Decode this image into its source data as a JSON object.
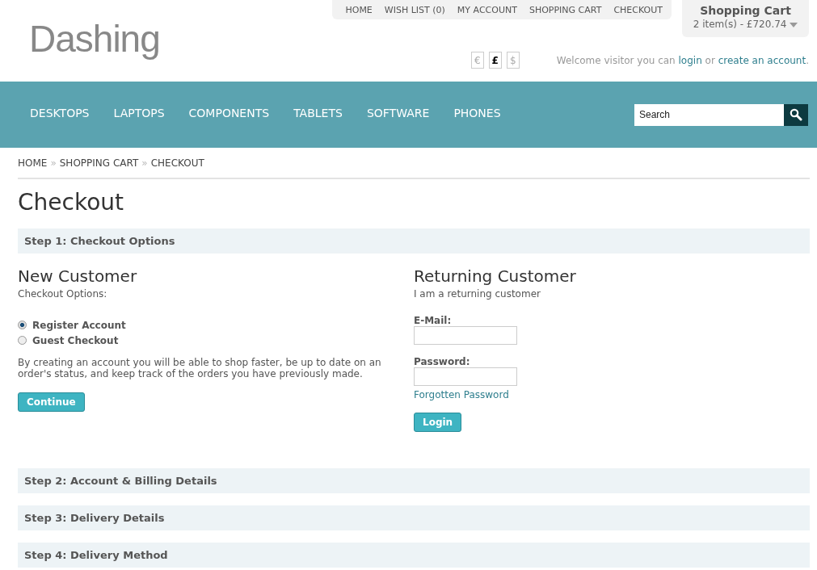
{
  "logo": "Dashing",
  "top_links": [
    "HOME",
    "WISH LIST (0)",
    "MY ACCOUNT",
    "SHOPPING CART",
    "CHECKOUT"
  ],
  "cart": {
    "title": "Shopping Cart",
    "summary": "2 item(s) - £720.74"
  },
  "currencies": [
    {
      "symbol": "€",
      "selected": false
    },
    {
      "symbol": "£",
      "selected": true
    },
    {
      "symbol": "$",
      "selected": false
    }
  ],
  "welcome": {
    "before": "Welcome visitor you can",
    "login": "login",
    "middle": "or",
    "register": "create an account",
    "after": "."
  },
  "nav": [
    "DESKTOPS",
    "LAPTOPS",
    "COMPONENTS",
    "TABLETS",
    "SOFTWARE",
    "PHONES"
  ],
  "search": {
    "placeholder": "Search"
  },
  "breadcrumb": [
    {
      "label": "HOME",
      "separator": "»"
    },
    {
      "label": "SHOPPING CART",
      "separator": "»"
    },
    {
      "label": "CHECKOUT"
    }
  ],
  "heading": "Checkout",
  "step1": {
    "title": "Step 1: Checkout Options",
    "new_customer": {
      "title": "New Customer",
      "subtitle": "Checkout Options:",
      "options": [
        {
          "label": "Register Account",
          "selected": true
        },
        {
          "label": "Guest Checkout",
          "selected": false
        }
      ],
      "text": "By creating an account you will be able to shop faster, be up to date on an order's status, and keep track of the orders you have previously made.",
      "button": "Continue"
    },
    "returning_customer": {
      "title": "Returning Customer",
      "subtitle": "I am a returning customer",
      "email_label": "E-Mail:",
      "password_label": "Password:",
      "forgotten": "Forgotten Password",
      "button": "Login"
    }
  },
  "steps": [
    "Step 2: Account & Billing Details",
    "Step 3: Delivery Details",
    "Step 4: Delivery Method"
  ]
}
